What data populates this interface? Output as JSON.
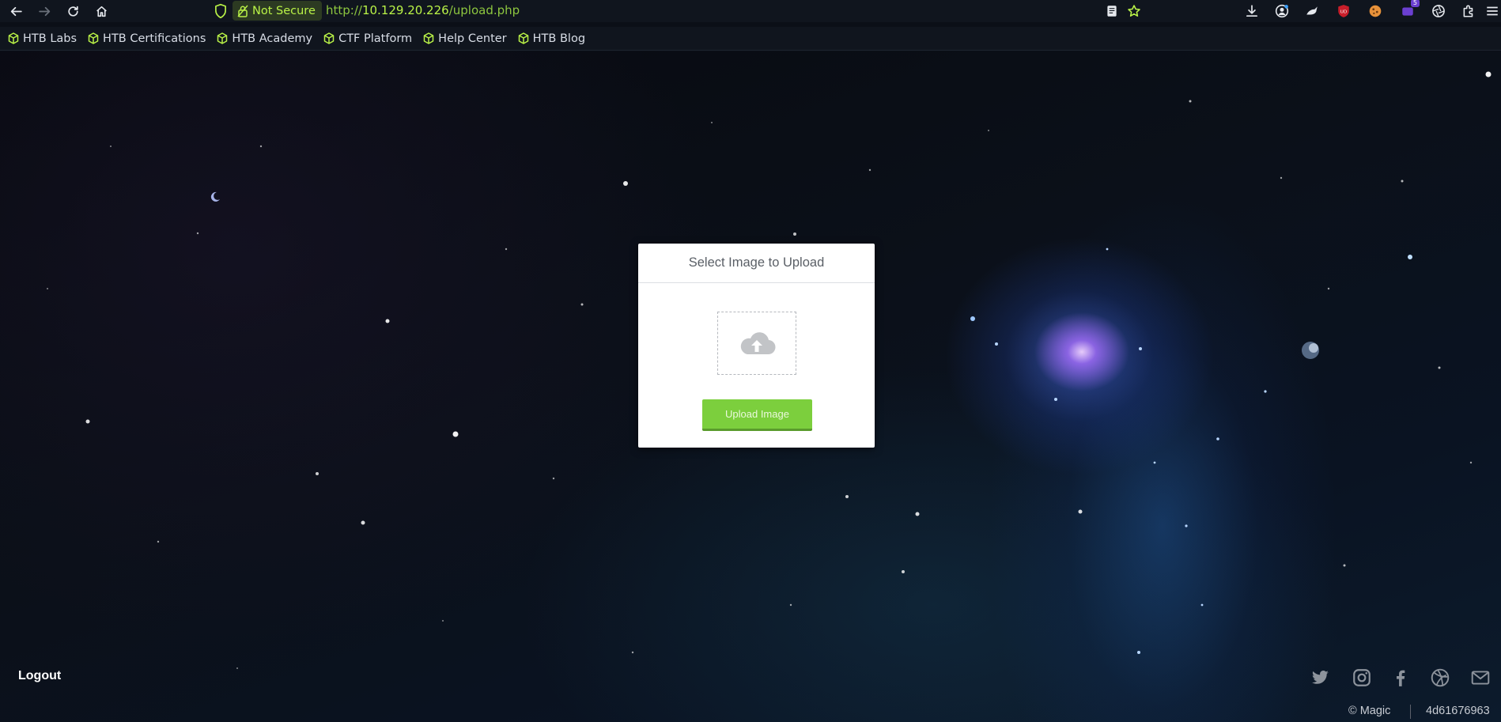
{
  "browser": {
    "security_label": "Not Secure",
    "url_scheme": "http://",
    "url_host": "10.129.20.226",
    "url_path": "/upload.php",
    "extension_badge": "5",
    "ext_label": "UD"
  },
  "bookmarks": [
    {
      "label": "HTB Labs"
    },
    {
      "label": "HTB Certifications"
    },
    {
      "label": "HTB Academy"
    },
    {
      "label": "CTF Platform"
    },
    {
      "label": "Help Center"
    },
    {
      "label": "HTB Blog"
    }
  ],
  "upload": {
    "title": "Select Image to Upload",
    "button_label": "Upload Image"
  },
  "footer": {
    "logout_label": "Logout",
    "copyright": "© Magic",
    "hash": "4d61676963"
  },
  "colors": {
    "accent_green": "#b9f247",
    "button_green": "#7ccf3d"
  }
}
